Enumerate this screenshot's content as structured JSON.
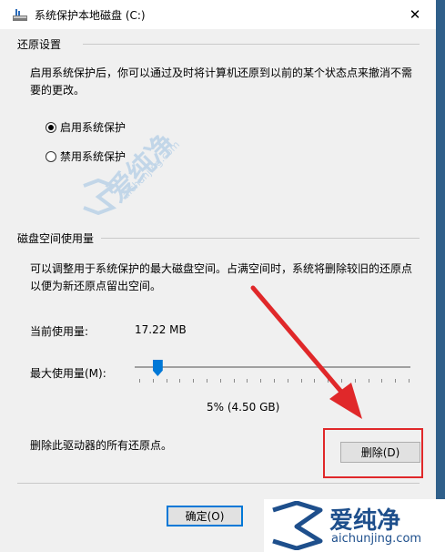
{
  "window": {
    "title": "系统保护本地磁盘 (C:)",
    "close_glyph": "✕"
  },
  "restore": {
    "header": "还原设置",
    "description": "启用系统保护后，你可以通过及时将计算机还原到以前的某个状态点来撤消不需要的更改。",
    "options": [
      {
        "label": "启用系统保护",
        "selected": true
      },
      {
        "label": "禁用系统保护",
        "selected": false
      }
    ]
  },
  "disk": {
    "header": "磁盘空间使用量",
    "description": "可以调整用于系统保护的最大磁盘空间。占满空间时，系统将删除较旧的还原点以便为新还原点留出空间。",
    "current_usage_label": "当前使用量:",
    "current_usage_value": "17.22 MB",
    "max_usage_label": "最大使用量(M):",
    "max_usage_percent": 5,
    "max_usage_value": "5% (4.50 GB)",
    "delete_text": "删除此驱动器的所有还原点。",
    "delete_button": "删除(D)"
  },
  "footer": {
    "ok_button": "确定(O)"
  },
  "watermark": {
    "text": "爱纯净",
    "url": "aichunjing.com"
  },
  "logo": {
    "text_cn": "爱纯净",
    "text_en": "aichunjing.com"
  },
  "colors": {
    "accent": "#0078d7",
    "highlight": "#e0282a",
    "logo": "#1e4f8c"
  }
}
